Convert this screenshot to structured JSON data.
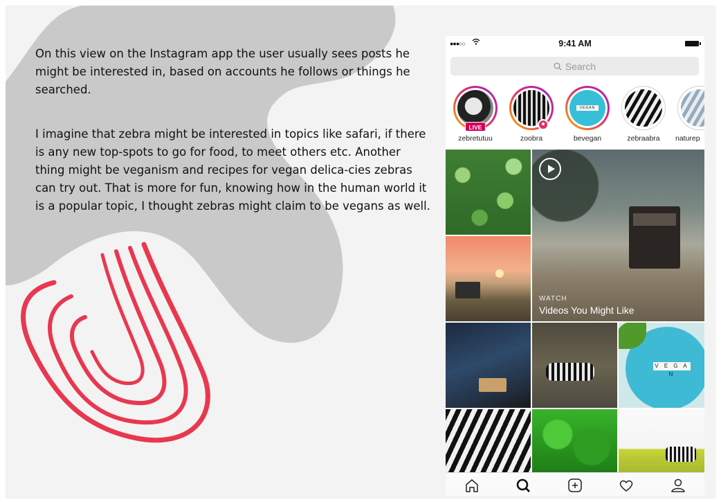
{
  "description": {
    "paragraph1": "On this view on the Instagram app the user usually sees posts he might be interested in, based on accounts he follows or things he searched.",
    "paragraph2": "I imagine that zebra might be interested in topics like safari, if there is any new top-spots to go for food, to meet others etc. Another thing might be veganism and recipes for vegan delica-cies zebras can try out. That is more for fun, knowing how in the human world it is a popular topic, I thought zebras might claim to be vegans as well."
  },
  "status_bar": {
    "signal": "●●●○○",
    "time": "9:41 AM"
  },
  "search": {
    "placeholder": "Search"
  },
  "stories": [
    {
      "username": "zebretutuu",
      "badge": "LIVE"
    },
    {
      "username": "zoobra"
    },
    {
      "username": "bevegan",
      "image_text": "VEGAN"
    },
    {
      "username": "zebraabra"
    },
    {
      "username": "naturep"
    }
  ],
  "explore": {
    "video_label": "WATCH",
    "video_title": "Videos You Might Like",
    "plate_text": "V E G A N"
  },
  "tab_bar": [
    "home-icon",
    "search-icon",
    "add-post-icon",
    "heart-icon",
    "profile-icon"
  ],
  "colors": {
    "accent_red": "#e8384f",
    "live_badge": "#d3005c",
    "background": "#f3f3f3",
    "blob_gray": "#c9c9c9"
  }
}
